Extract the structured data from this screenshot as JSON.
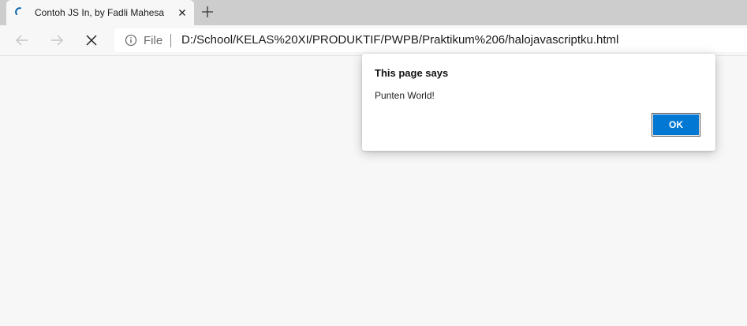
{
  "browser": {
    "tab": {
      "title": "Contoh JS In, by Fadli Mahesa",
      "loading": true
    },
    "address_bar": {
      "scheme_label": "File",
      "url": "D:/School/KELAS%20XI/PRODUKTIF/PWPB/Praktikum%206/halojavascriptku.html"
    },
    "icons": {
      "back": "back-arrow-icon",
      "forward": "forward-arrow-icon",
      "stop": "close-icon",
      "info": "info-icon",
      "new_tab": "plus-icon",
      "tab_close": "close-icon",
      "loading": "loading-spinner-icon"
    }
  },
  "dialog": {
    "title": "This page says",
    "message": "Punten World!",
    "ok_label": "OK"
  },
  "colors": {
    "accent": "#0078d4",
    "tab_strip": "#cdcdcd",
    "page_background": "#f7f7f7",
    "spinner": "#0063b1"
  }
}
